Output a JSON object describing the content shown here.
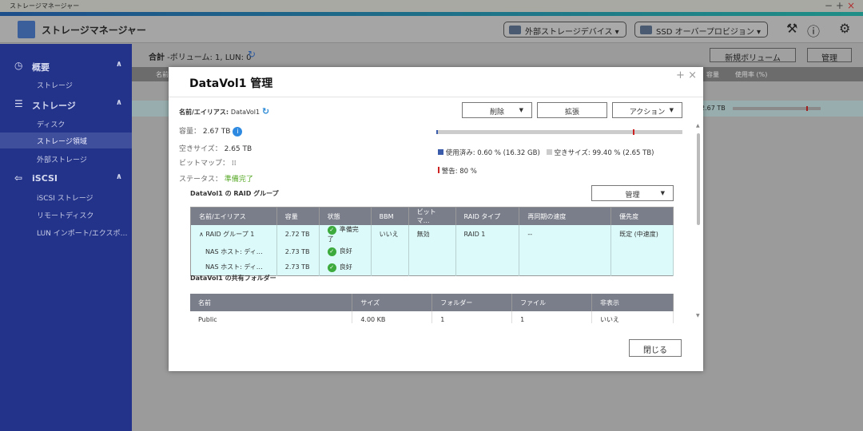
{
  "window": {
    "title": "ストレージマネージャー",
    "controls": [
      "−",
      "+",
      "×"
    ]
  },
  "header": {
    "app_title": "ストレージマネージャー",
    "external_storage": "外部ストレージデバイス ▾",
    "ssd_overprovision": "SSD オーバープロビジョン ▾"
  },
  "sidebar": {
    "items": [
      {
        "label": "概要",
        "level": "top",
        "icon": "gauge-icon"
      },
      {
        "label": "ストレージ",
        "level": "sub"
      },
      {
        "label": "ストレージ",
        "level": "top",
        "icon": "database-icon"
      },
      {
        "label": "ディスク",
        "level": "sub"
      },
      {
        "label": "ストレージ領域",
        "level": "sub",
        "selected": true
      },
      {
        "label": "外部ストレージ",
        "level": "sub"
      },
      {
        "label": "iSCSI",
        "level": "top",
        "icon": "iscsi-icon"
      },
      {
        "label": "iSCSI ストレージ",
        "level": "sub"
      },
      {
        "label": "リモートディスク",
        "level": "sub"
      },
      {
        "label": "LUN インポート/エクスポ…",
        "level": "sub"
      }
    ]
  },
  "main": {
    "summary_bold": "合計",
    "summary_rest": " -ボリューム: 1, LUN: 0",
    "new_volume": "新規ボリューム",
    "manage": "管理",
    "columns": {
      "name": "名前",
      "capacity": "容量",
      "usage": "使用率 (%)"
    },
    "row_capacity": "2.67 TB",
    "row_usage_percent": 0.6
  },
  "dialog": {
    "title": "DataVol1  管理",
    "name_label": "名前/エイリアス:",
    "name_value": "DataVol1",
    "capacity_label": "容量：",
    "capacity_value": "2.67 TB",
    "free_label": "空きサイズ：",
    "free_value": "2.65 TB",
    "bitmap_label": "ビットマップ：",
    "status_label": "ステータス：",
    "status_value": "準備完了",
    "delete": "削除",
    "expand": "拡張",
    "action": "アクション",
    "usage": {
      "used_percent": 0.6,
      "warning_percent": 80,
      "used_text": "使用済み: 0.60 % (16.32 GB)",
      "free_text": "空きサイズ: 99.40 % (2.65 TB)",
      "warning_text": "警告: 80 %",
      "used_color": "#3b5cab",
      "warning_color": "#cc2222"
    },
    "raid_title": "DataVol1 の RAID グループ",
    "raid_manage": "管理",
    "raid_columns": [
      "名前/エイリアス",
      "容量",
      "状態",
      "BBM",
      "ビットマ…",
      "RAID タイプ",
      "再同期の速度",
      "優先度"
    ],
    "raid_rows": [
      [
        "∧  RAID グループ 1",
        "2.72 TB",
        "準備完了",
        "いいえ",
        "無効",
        "RAID 1",
        "--",
        "既定 (中速度)"
      ],
      [
        "NAS ホスト: ディ…",
        "2.73 TB",
        "良好",
        "",
        "",
        "",
        "",
        ""
      ],
      [
        "NAS ホスト: ディ…",
        "2.73 TB",
        "良好",
        "",
        "",
        "",
        "",
        ""
      ]
    ],
    "shared_title": "DataVol1 の共有フォルダー",
    "shared_columns": [
      "名前",
      "サイズ",
      "フォルダー",
      "ファイル",
      "非表示"
    ],
    "shared_rows": [
      [
        "Public",
        "4.00 KB",
        "1",
        "1",
        "いいえ"
      ]
    ],
    "close": "閉じる"
  }
}
